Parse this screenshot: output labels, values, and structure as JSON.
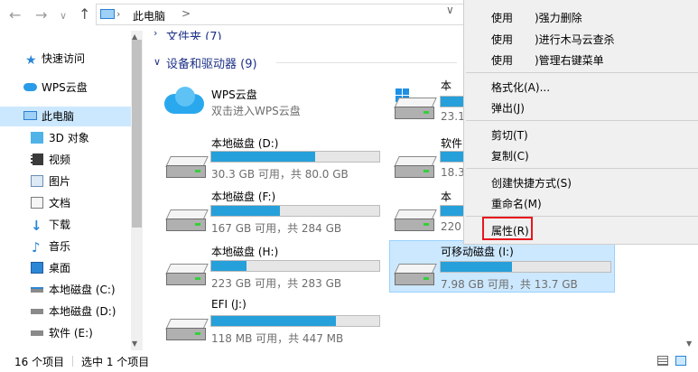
{
  "address": {
    "back": "←",
    "forward": "→",
    "recent": "∨",
    "up": "↑",
    "path": "此电脑",
    "chevron": ">",
    "dropdown": "∨"
  },
  "nav": {
    "items": [
      {
        "label": "快速访问",
        "icon": "star-icon"
      },
      {
        "label": "WPS云盘",
        "icon": "cloud-icon"
      },
      {
        "label": "此电脑",
        "icon": "computer-icon"
      },
      {
        "label": "3D 对象",
        "icon": "3d-objects-icon"
      },
      {
        "label": "视频",
        "icon": "video-icon"
      },
      {
        "label": "图片",
        "icon": "pictures-icon"
      },
      {
        "label": "文档",
        "icon": "documents-icon"
      },
      {
        "label": "下载",
        "icon": "download-icon"
      },
      {
        "label": "音乐",
        "icon": "music-icon"
      },
      {
        "label": "桌面",
        "icon": "desktop-icon"
      },
      {
        "label": "本地磁盘 (C:)",
        "icon": "drive-c-icon"
      },
      {
        "label": "本地磁盘 (D:)",
        "icon": "drive-icon"
      },
      {
        "label": "软件 (E:)",
        "icon": "drive-icon"
      }
    ]
  },
  "main": {
    "folders_header": "文件夹 (7)",
    "devices_header": "设备和驱动器 (9)",
    "wps": {
      "name": "WPS云盘",
      "sub": "双击进入WPS云盘"
    },
    "drives": [
      {
        "name": "本地磁盘 (D:)",
        "sub": "30.3 GB 可用，共 80.0 GB",
        "used": 0.62
      },
      {
        "name": "本地磁盘 (F:)",
        "sub": "167 GB 可用，共 284 GB",
        "used": 0.41
      },
      {
        "name": "本地磁盘 (H:)",
        "sub": "223 GB 可用，共 283 GB",
        "used": 0.21
      },
      {
        "name": "EFI (J:)",
        "sub": "118 MB 可用，共 447 MB",
        "used": 0.74
      }
    ],
    "partial_right": [
      {
        "name": "本",
        "sub": "23.1"
      },
      {
        "name": "软件",
        "sub": "18.3"
      },
      {
        "name": "本",
        "sub": "220"
      }
    ],
    "removable": {
      "name": "可移动磁盘 (I:)",
      "sub": "7.98 GB 可用，共 13.7 GB",
      "used": 0.42
    }
  },
  "context_menu": {
    "items_top": [
      "使用　　)强力删除",
      "使用　　)进行木马云查杀",
      "使用　　)管理右键菜单"
    ],
    "format": "格式化(A)...",
    "eject": "弹出(J)",
    "cut": "剪切(T)",
    "copy": "复制(C)",
    "shortcut": "创建快捷方式(S)",
    "rename": "重命名(M)",
    "properties": "属性(R)"
  },
  "status": {
    "count": "16 个项目",
    "selected": "选中 1 个项目"
  },
  "colors": {
    "accent": "#26a0da",
    "selection": "#cce8ff",
    "highlight": "#e8171d"
  }
}
